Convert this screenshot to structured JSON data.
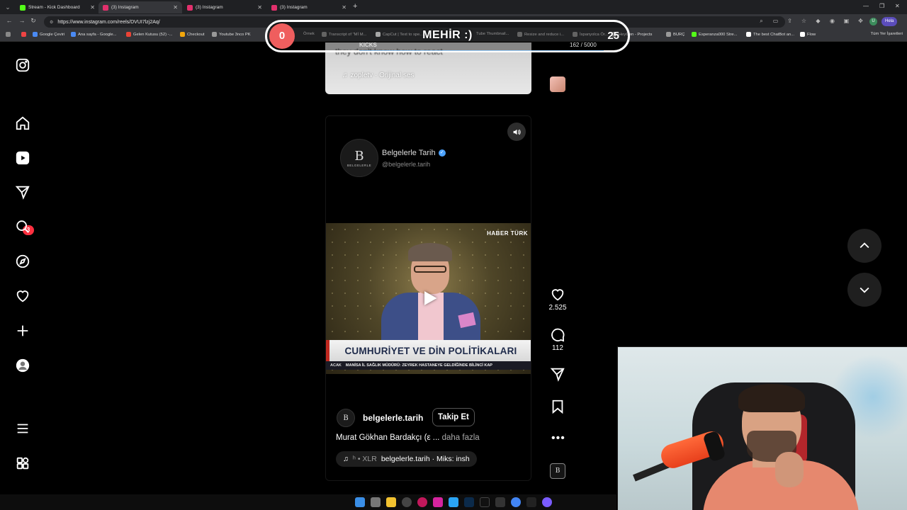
{
  "browser": {
    "tabs": [
      {
        "label": "Stream - Kick Dashboard",
        "color": "#53fc18",
        "active": false
      },
      {
        "label": "(3) Instagram",
        "color": "#e1306c",
        "active": true
      },
      {
        "label": "(3) Instagram",
        "color": "#e1306c",
        "active": false
      },
      {
        "label": "(3) Instagram",
        "color": "#e1306c",
        "active": false
      }
    ],
    "url": "https://www.instagram.com/reels/DVUI7lzj2Aq/",
    "profile_label": "Hela",
    "bookmarks": [
      "Google Çeviri",
      "Ana sayfa - Google...",
      "Gelen Kutusu (52) -...",
      "Checkout",
      "Youtube 3nco PK",
      "Örnek",
      "Transcript of \"Mİ M...",
      "CapCut | Text to spe...",
      "Tube Thumbnail...",
      "Resize and reduce i...",
      "İspanyolca Ör...",
      "HeyGen - Projects",
      "BURÇ",
      "Esperanza000 Stre...",
      "The best ChatBot an...",
      "Flow"
    ],
    "bookmarks_right": "Tüm Yer İşaretleri"
  },
  "overlay": {
    "kicks_count": "0",
    "title": "MEHİR :)",
    "label": "KICKS",
    "goal": "162 / 5000",
    "target": "25"
  },
  "sidebar": {
    "icons": [
      "instagram-logo-icon",
      "home-icon",
      "reels-icon",
      "messages-icon",
      "search-icon",
      "explore-icon",
      "heart-icon",
      "create-icon",
      "profile-icon",
      "menu-icon",
      "more-apps-icon"
    ],
    "notification_count": "3"
  },
  "previous_reel": {
    "caption_fragment": "they don't know how to react",
    "audio": "zopletv · Orijinal ses"
  },
  "reel": {
    "header_name": "Belgelerle Tarih",
    "header_handle": "@belgelerle.tarih",
    "logo_letter": "B",
    "logo_word": "BELGELERLE",
    "channel_logo": "HABER TÜRK",
    "banner": "CUMHURİYET VE DİN POLİTİKALARI",
    "ticker_tag": "ACAK",
    "ticker": "MANİSA İL SAĞLIK MÜDÜRÜ: ZEYREK HASTANEYE GELDİĞİNDE BİLİNCİ KAP",
    "username": "belgelerle.tarih",
    "follow_label": "Takip Et",
    "caption": "Murat Gökhan Bardakçı (ε ...",
    "caption_more": "daha fazla",
    "audio_prefix": "ʰ • XLR",
    "audio_text": "belgelerle.tarih · Miks: insh"
  },
  "actions": {
    "likes": "2.525",
    "comments": "112"
  }
}
